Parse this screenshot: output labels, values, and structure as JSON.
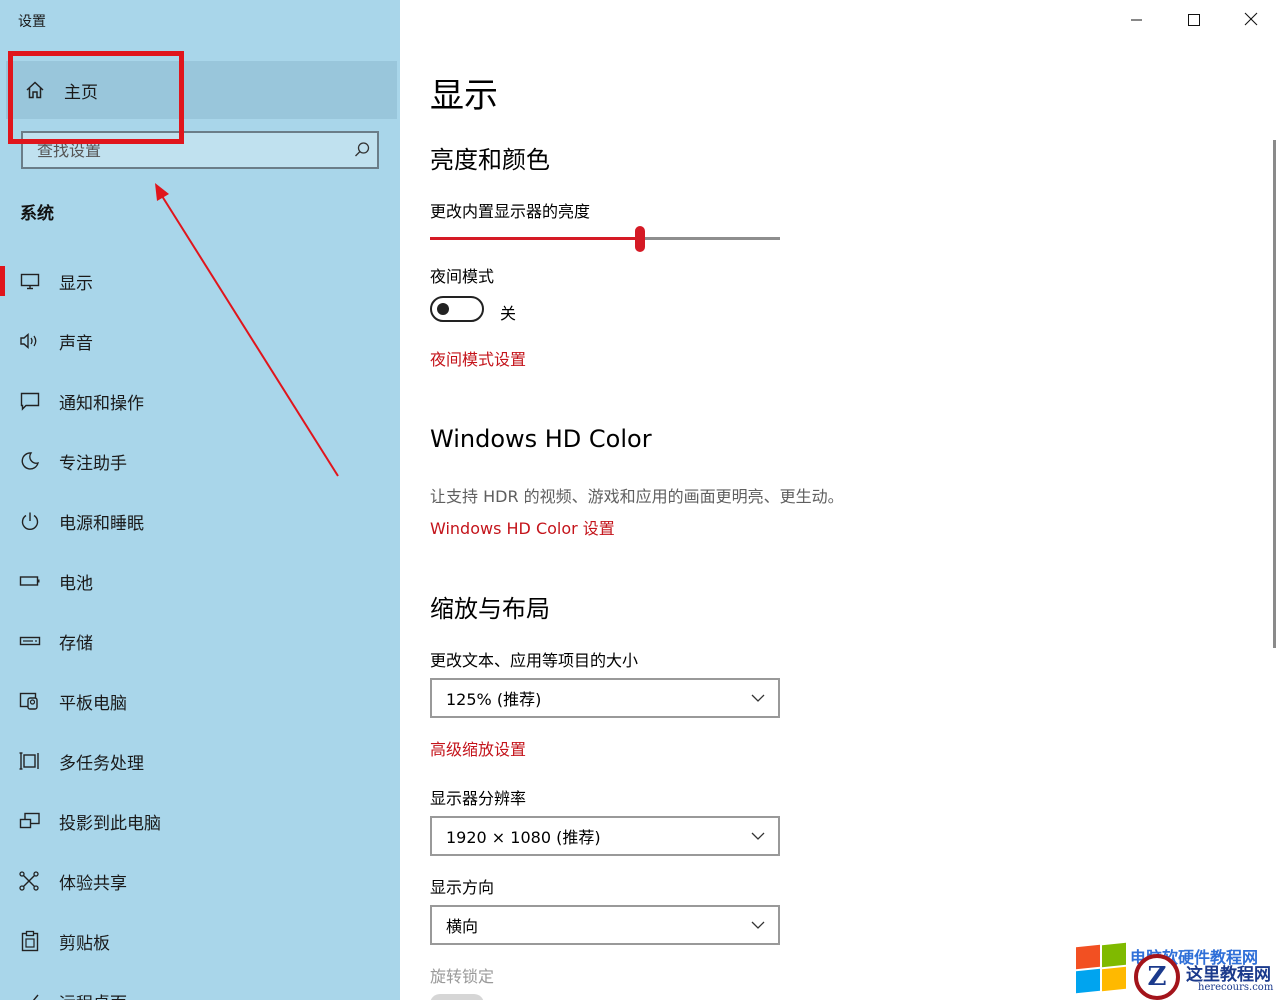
{
  "window": {
    "title": "设置",
    "controls": [
      "minimize",
      "maximize",
      "close"
    ]
  },
  "sidebar": {
    "home_label": "主页",
    "search": {
      "placeholder": "查找设置"
    },
    "section_title": "系统",
    "items": [
      {
        "label": "显示",
        "icon": "monitor-icon",
        "active": true
      },
      {
        "label": "声音",
        "icon": "speaker-icon"
      },
      {
        "label": "通知和操作",
        "icon": "notification-icon"
      },
      {
        "label": "专注助手",
        "icon": "moon-icon"
      },
      {
        "label": "电源和睡眠",
        "icon": "power-icon"
      },
      {
        "label": "电池",
        "icon": "battery-icon"
      },
      {
        "label": "存储",
        "icon": "storage-icon"
      },
      {
        "label": "平板电脑",
        "icon": "tablet-icon"
      },
      {
        "label": "多任务处理",
        "icon": "multitask-icon"
      },
      {
        "label": "投影到此电脑",
        "icon": "project-icon"
      },
      {
        "label": "体验共享",
        "icon": "share-icon"
      },
      {
        "label": "剪贴板",
        "icon": "clipboard-icon"
      },
      {
        "label": "远程桌面",
        "icon": "remote-desktop-icon"
      }
    ]
  },
  "main": {
    "title": "显示",
    "brightness_section": {
      "heading": "亮度和颜色",
      "brightness_label": "更改内置显示器的亮度",
      "brightness_value": 0.6,
      "night_mode_label": "夜间模式",
      "night_mode_state": "关",
      "night_mode_on": false,
      "night_mode_settings_link": "夜间模式设置"
    },
    "hdr_section": {
      "heading": "Windows HD Color",
      "description": "让支持 HDR 的视频、游戏和应用的画面更明亮、更生动。",
      "settings_link": "Windows HD Color 设置"
    },
    "scale_section": {
      "heading": "缩放与布局",
      "scale_label": "更改文本、应用等项目的大小",
      "scale_value": "125% (推荐)",
      "advanced_scaling_link": "高级缩放设置",
      "resolution_label": "显示器分辨率",
      "resolution_value": "1920 × 1080 (推荐)",
      "orientation_label": "显示方向",
      "orientation_value": "横向",
      "rotation_lock_label": "旋转锁定"
    }
  },
  "colors": {
    "accent": "#d51a25",
    "sidebar_bg": "#a9d6ea",
    "annotation": "#e0151c"
  },
  "watermark": {
    "brand": "这里教程网",
    "domain": "herecours.com",
    "top_text": "电脑软硬件教程网"
  }
}
